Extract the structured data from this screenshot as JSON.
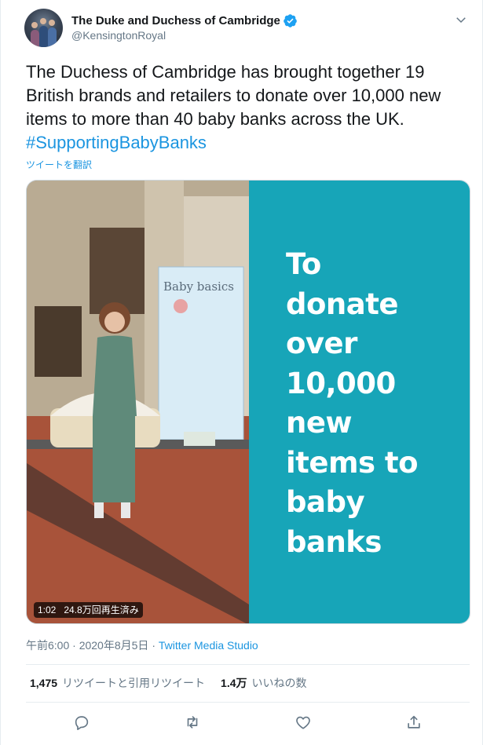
{
  "author": {
    "display_name": "The Duke and Duchess of Cambridge",
    "handle": "@KensingtonRoyal",
    "verified": true
  },
  "tweet": {
    "text": "The Duchess of Cambridge has brought together 19 British brands and retailers to donate over 10,000 new items to more than 40 baby banks across the UK.",
    "hashtag": "#SupportingBabyBanks",
    "translate_label": "ツイートを翻訳"
  },
  "media": {
    "type": "video",
    "panel_lines": [
      "To",
      "donate",
      "over",
      "10,000",
      "new",
      "items to",
      "baby",
      "banks"
    ],
    "duration": "1:02",
    "views": "24.8万回再生済み",
    "sign_text": "Baby basics",
    "panel_color": "#17a5b8"
  },
  "meta": {
    "time": "午前6:00",
    "separator1": "·",
    "date": "2020年8月5日",
    "separator2": "·",
    "source": "Twitter Media Studio"
  },
  "stats": {
    "retweets_count": "1,475",
    "retweets_label": "リツイートと引用リツイート",
    "likes_count": "1.4万",
    "likes_label": "いいねの数"
  },
  "actions": {
    "icons": [
      "reply-icon",
      "retweet-icon",
      "like-icon",
      "share-icon"
    ]
  },
  "colors": {
    "link": "#1b95e0",
    "secondary_text": "#657786",
    "verified": "#1da1f2"
  }
}
